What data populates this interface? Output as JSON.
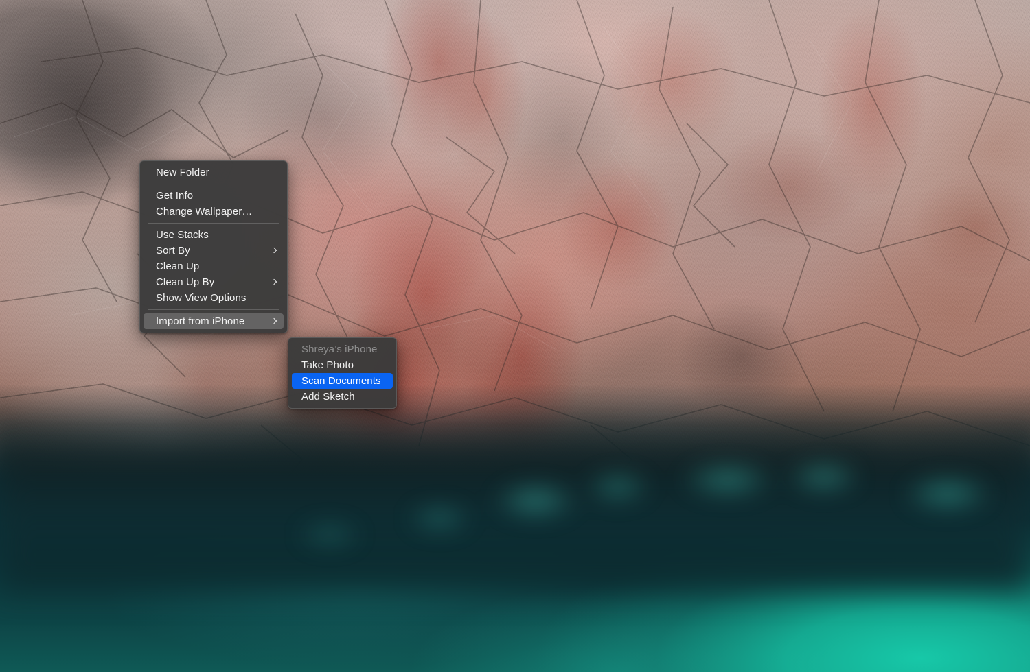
{
  "desktop": {
    "wallpaper_name": "rocky-coastline-wallpaper",
    "description": "Pink and gray granite coastal rocks above deep teal water",
    "colors": {
      "rock_pink": "#c98d85",
      "rock_gray": "#8c8a8a",
      "rock_rust": "#a9786a",
      "water_deep": "#0d2d33",
      "water_bright": "#17c8a8"
    }
  },
  "context_menu": {
    "name": "desktop-context-menu",
    "background_color": "#3a3a3a",
    "text_color": "#f2f2f2",
    "highlight_color": "#7a7a7a",
    "groups": [
      {
        "items": [
          {
            "label": "New Folder",
            "has_submenu": false,
            "state": "normal"
          }
        ]
      },
      {
        "items": [
          {
            "label": "Get Info",
            "has_submenu": false,
            "state": "normal"
          },
          {
            "label": "Change Wallpaper…",
            "has_submenu": false,
            "state": "normal"
          }
        ]
      },
      {
        "items": [
          {
            "label": "Use Stacks",
            "has_submenu": false,
            "state": "normal"
          },
          {
            "label": "Sort By",
            "has_submenu": true,
            "state": "normal"
          },
          {
            "label": "Clean Up",
            "has_submenu": false,
            "state": "normal"
          },
          {
            "label": "Clean Up By",
            "has_submenu": true,
            "state": "normal"
          },
          {
            "label": "Show View Options",
            "has_submenu": false,
            "state": "normal"
          }
        ]
      },
      {
        "items": [
          {
            "label": "Import from iPhone",
            "has_submenu": true,
            "state": "highlighted"
          }
        ]
      }
    ]
  },
  "submenu": {
    "name": "import-from-iphone-submenu",
    "accent_color": "#0a64f2",
    "disabled_color": "#8d8d8d",
    "items": [
      {
        "label": "Shreya’s iPhone",
        "state": "disabled"
      },
      {
        "label": "Take Photo",
        "state": "normal"
      },
      {
        "label": "Scan Documents",
        "state": "selected"
      },
      {
        "label": "Add Sketch",
        "state": "normal"
      }
    ]
  }
}
